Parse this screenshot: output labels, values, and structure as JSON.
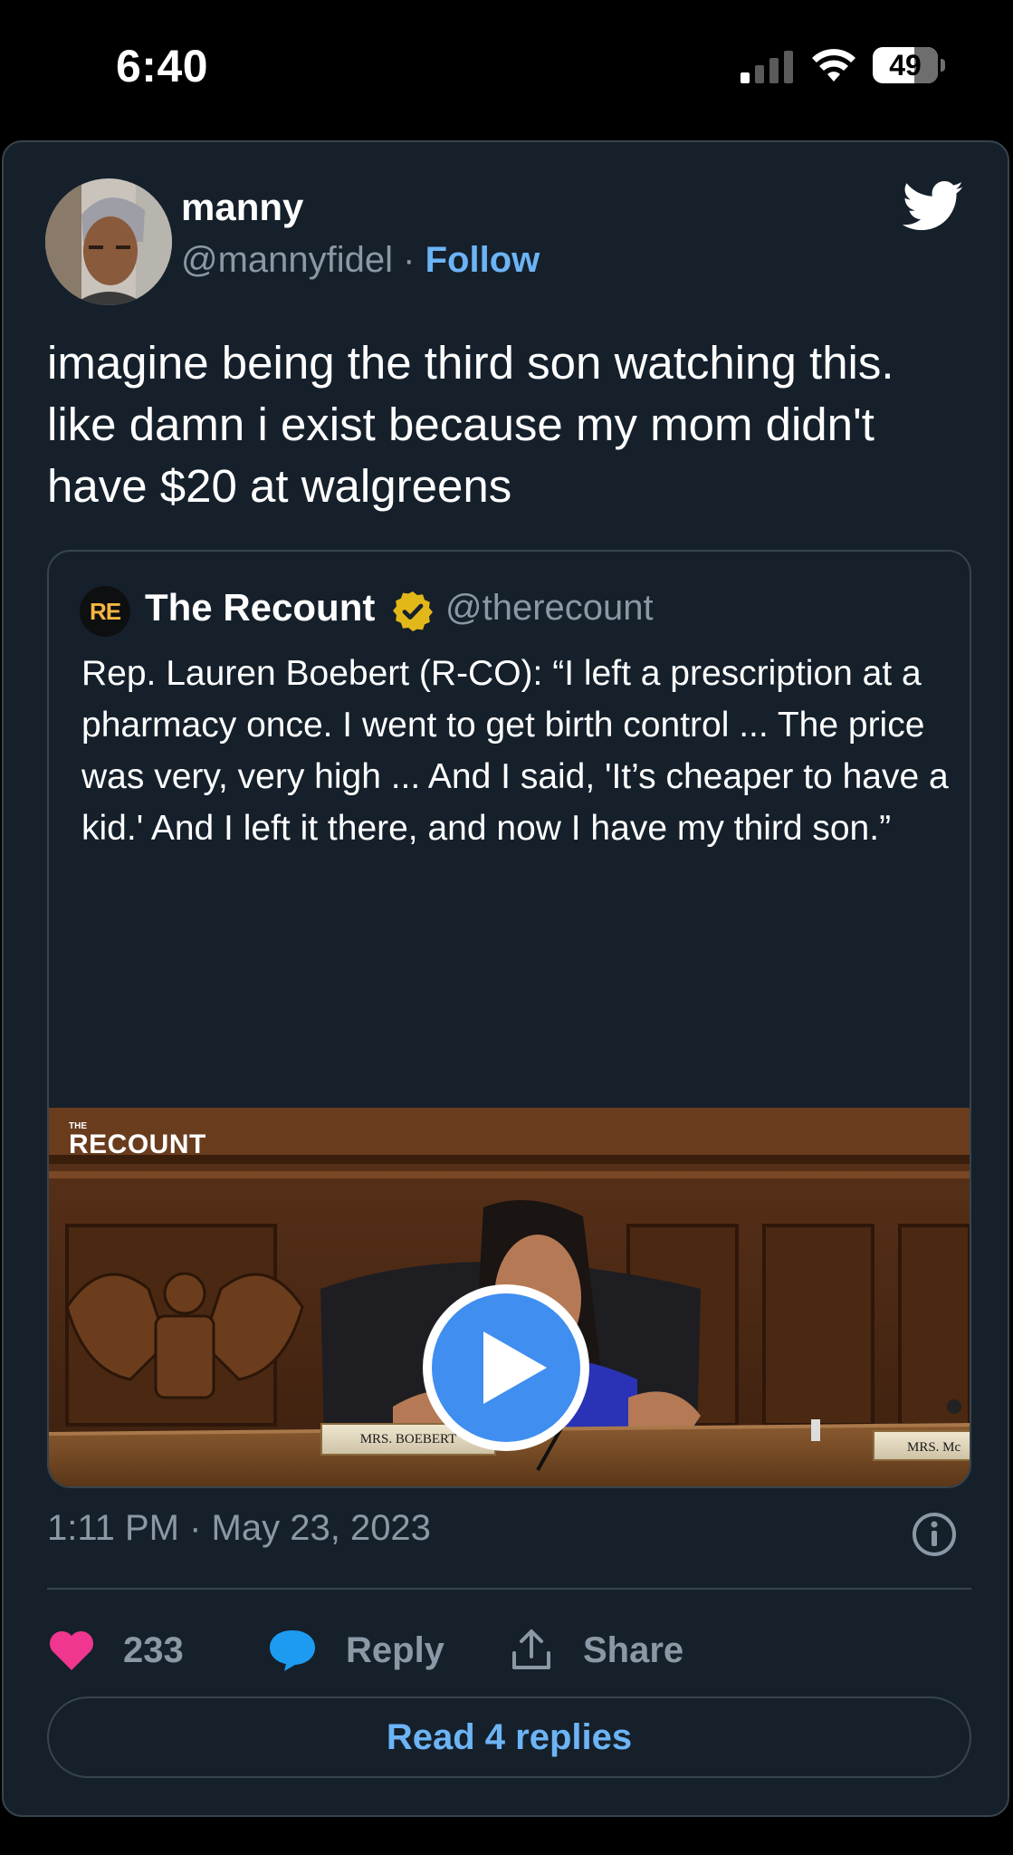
{
  "status_bar": {
    "time": "6:40",
    "battery_level": "49",
    "icons": [
      "cellular-signal-icon",
      "wifi-icon",
      "battery-icon"
    ]
  },
  "tweet": {
    "author_name": "manny",
    "author_handle": "@mannyfidel",
    "separator": "·",
    "follow_label": "Follow",
    "text": "imagine being the third son watching this. like damn i exist because my mom didn't have $20 at walgreens",
    "timestamp": "1:11 PM · May 23, 2023",
    "likes": "233",
    "reply_label": "Reply",
    "share_label": "Share",
    "read_replies_label": "Read 4 replies"
  },
  "quoted_tweet": {
    "logo_text": "RE",
    "author_name": "The Recount",
    "author_handle": "@therecount",
    "text": "Rep. Lauren Boebert (R-CO): “I left a prescription at a pharmacy once. I went to get birth control ... The price was very, very high ... And I said, 'It’s cheaper to have a kid.' And I left it there, and now I have my third son.”",
    "video": {
      "watermark_small": "THE",
      "watermark_big": "RECOUNT",
      "nameplate_main": "MRS. BOEBERT",
      "nameplate_side": "MRS. Mc"
    }
  },
  "colors": {
    "background": "#15202b",
    "border": "#38444d",
    "link": "#6cb4f5",
    "muted_text": "#8b98a5",
    "like": "#f0368f",
    "reply_bubble": "#1d9bf0",
    "twitter_blue": "#ffffff",
    "play_button": "#3f8ef0"
  }
}
